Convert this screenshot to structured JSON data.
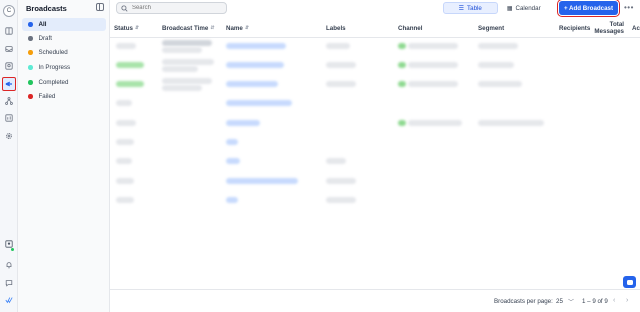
{
  "rail": {
    "avatar_letter": "C",
    "icons": [
      "book-icon",
      "inbox-icon",
      "contacts-icon",
      "broadcast-icon",
      "workflow-icon",
      "reports-icon",
      "settings-icon"
    ],
    "bottom_icons": [
      "user-status-icon",
      "bell-icon",
      "help-icon",
      "brand-icon"
    ]
  },
  "sidebar": {
    "title": "Broadcasts",
    "items": [
      {
        "label": "All",
        "color": "#2563eb"
      },
      {
        "label": "Draft",
        "color": "#6b7280"
      },
      {
        "label": "Scheduled",
        "color": "#f59e0b"
      },
      {
        "label": "In Progress",
        "color": "#5eead4"
      },
      {
        "label": "Completed",
        "color": "#22c55e"
      },
      {
        "label": "Failed",
        "color": "#dc2626"
      }
    ]
  },
  "toolbar": {
    "search_placeholder": "Search",
    "view_table": "Table",
    "view_calendar": "Calendar",
    "add_button": "+ Add Broadcast",
    "more": "•••"
  },
  "table": {
    "columns": {
      "status": "Status",
      "broadcast_time": "Broadcast Time",
      "name": "Name",
      "labels": "Labels",
      "channel": "Channel",
      "segment": "Segment",
      "recipients": "Recipients",
      "total_messages_1": "Total",
      "total_messages_2": "Messages",
      "actions": "Ac"
    }
  },
  "footer": {
    "per_page_label": "Broadcasts per page:",
    "per_page": "25",
    "range": "1 – 9 of 9"
  },
  "colors": {
    "accent": "#2563eb",
    "highlight_border": "#dc2626"
  }
}
